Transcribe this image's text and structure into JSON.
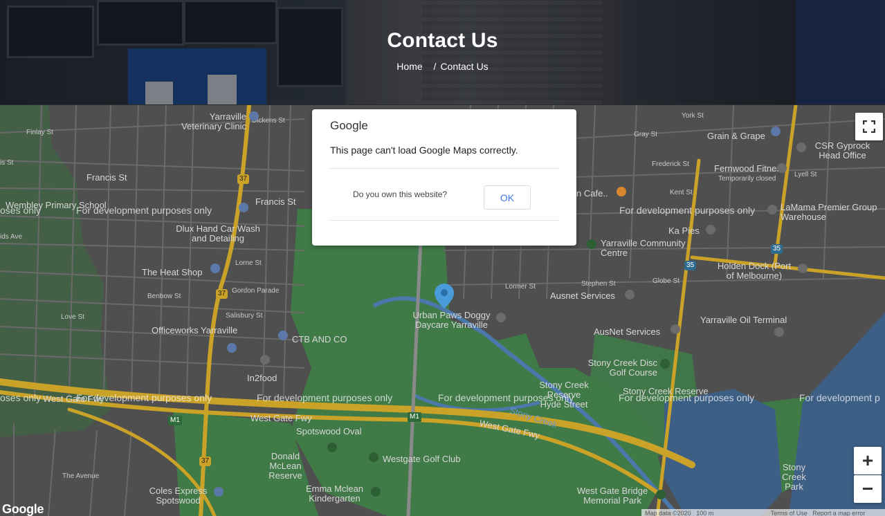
{
  "header": {
    "title": "Contact Us",
    "breadcrumb": {
      "home": "Home",
      "separator": "/",
      "current": "Contact Us"
    }
  },
  "map": {
    "watermark": "For development purposes only",
    "watermark_partial_left": "oses only",
    "watermark_partial_right": "For development p",
    "labels": {
      "finlay": "Finlay St",
      "francis_left": "Francis St",
      "francis_mid": "Francis St",
      "wembley": "Wembley Primary School",
      "yarraville_vet": "Yarraville Veterinary Clinic",
      "dickens": "Dickens St",
      "dlux": "Dlux Hand Car Wash and Detailing",
      "heat_shop": "The Heat Shop",
      "lorne": "Lorne St",
      "gordon": "Gordon Parade",
      "benbow": "Benbow St",
      "salisbury": "Salisbury St",
      "officeworks": "Officeworks Yarraville",
      "ctb": "CTB AND CO",
      "in2food": "In2food",
      "west_gate_left": "West Gate Fwy",
      "west_gate_mid": "West Gate Fwy",
      "west_gate_right": "West Gate Fwy",
      "spotswood_oval": "Spotswood Oval",
      "donald": "Donald McLean Reserve",
      "westgate_golf": "Westgate Golf Club",
      "coles": "Coles Express Spotswood",
      "emma": "Emma Mclean Kindergarten",
      "the_avenue": "The Avenue",
      "urban_paws": "Urban Paws Doggy Daycare Yarraville",
      "lormer": "Lormer St",
      "stony_creek_label": "Stony Creek",
      "stony_creek_hyde": "Stony Creek Reserve Hyde Street",
      "stony_creek_reserve": "Stony Creek Reserve",
      "stony_disc": "Stony Creek Disc Golf Course",
      "ausnet1": "Ausnet Services",
      "ausnet2": "AusNet Services",
      "yarraville_oil": "Yarraville Oil Terminal",
      "holden": "Holden Dock (Port of Melbourne)",
      "yarraville_cc": "Yarraville Community Centre",
      "ka_pies": "Ka Pies",
      "kent": "Kent St",
      "globe": "Globe St",
      "fernwood": "Fernwood Fitness",
      "fernwood_sub": "Temporarily closed",
      "grain": "Grain & Grape",
      "csr": "CSR Gyprock Head Office",
      "lamama": "LaMama Premier Group Warehouse",
      "frederick": "Frederick St",
      "york": "York St",
      "gray": "Gray St",
      "lyell": "Lyell St",
      "westgate_bridge": "West Gate Bridge Memorial Park",
      "stony_park": "Stony Creek Park",
      "cafe": "n Cafe..",
      "stephen": "Stephen St",
      "love": "Love St",
      "mono_m1a": "M1",
      "mono_m1b": "M1",
      "route35a": "35",
      "route35b": "35",
      "route37a": "37",
      "route37b": "37",
      "route37c": "37",
      "ids_ave": "ids Ave",
      "is_st": "is St"
    },
    "footer_logo": "Google",
    "attribution": {
      "map_data": "Map data ©2020",
      "scale": "100 m",
      "terms": "Terms of Use",
      "report": "Report a map error"
    },
    "zoom_in": "+",
    "zoom_out": "−"
  },
  "dialog": {
    "brand": "Google",
    "message": "This page can't load Google Maps correctly.",
    "question": "Do you own this website?",
    "ok_label": "OK"
  },
  "colors": {
    "pin": "#4a90d9",
    "road_major": "#c9a227",
    "park": "#3f7a47",
    "water": "#3d5f86"
  }
}
